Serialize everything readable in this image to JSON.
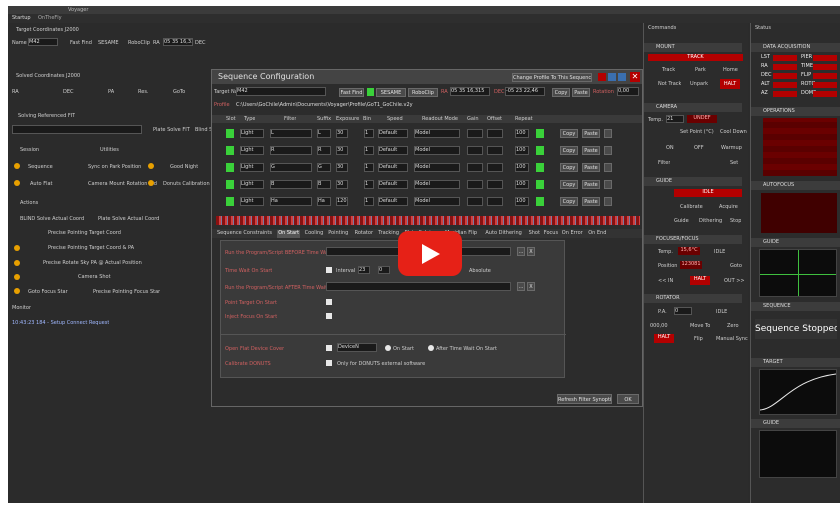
{
  "window": {
    "title": "Voyager",
    "tabs": [
      "Startup",
      "OnTheFly"
    ]
  },
  "left": {
    "target_coords_header": "Target Coordinates J2000",
    "name_label": "Name",
    "name_value": "M42",
    "fast_find": "Fast Find",
    "sesame": "SESAME",
    "roboclip": "RoboClip",
    "ra_label": "RA",
    "ra_value": "05 35 16,315",
    "dec_label": "DEC",
    "dec_value": "-05 23 22,46",
    "transit": "Transit",
    "goto": "Goto",
    "solved_header": "Solved Coordinates J2000",
    "solved_ra": "RA",
    "solved_dec": "DEC",
    "solved_pa": "PA",
    "solved_res": "Res.",
    "goto_btn": "GoTo",
    "solving_fit": "Solving Referenced FIT",
    "plate_solve_fit": "Plate Solve FIT",
    "blind_solve": "Blind Sol",
    "session": "Session",
    "utilities": "Utilities",
    "sequence": "Sequence",
    "sync_park": "Sync on Park Position",
    "good_night": "Good Night",
    "auto_flat": "Auto Flat",
    "camera_mount_rotation": "Camera Mount Rotation Aid",
    "donuts_calibration": "Donuts Calibration",
    "actions": "Actions",
    "blind_solve_actual": "BLIND Solve Actual Coord",
    "plate_solve_actual": "Plate Solve Actual Coord",
    "precise_target_coord": "Precise Pointing Target Coord",
    "precise_target_pa": "Precise Pointing Target Coord & PA",
    "precise_rotate_sky": "Precise Rotate Sky PA @ Actual Position",
    "camera_shot": "Camera Shot",
    "goto_focus_star": "Goto Focus Star",
    "precise_focus_star": "Precise Pointing Focus Star",
    "monitor_header": "Monitor",
    "monitor_log": "10:43:23 184 - Setup Connect Request"
  },
  "dialog": {
    "title": "Sequence Configuration",
    "change_profile": "Change Profile To This Sequence",
    "target_name_label": "Target Name",
    "target_name": "M42",
    "fast_find": "Fast Find",
    "sesame": "SESAME",
    "roboclip": "RoboClip",
    "ra_label": "RA",
    "ra_value": "05 35 16,315",
    "dec_label": "DEC",
    "dec_value": "-05 23 22,46",
    "copy": "Copy",
    "paste": "Paste",
    "rotation_label": "Rotation",
    "rotation_value": "0,00",
    "profile_label": "Profile",
    "profile_path": "C:\\Users\\GoChile\\Admin\\Documents\\Voyager\\Profile\\GoT1_GoChile.v2y",
    "columns": [
      "Slot",
      "Type",
      "Filter",
      "Suffix",
      "Exposure",
      "Bin",
      "Speed",
      "Readout Mode",
      "Gain",
      "Offset",
      "Repeat"
    ],
    "rows": [
      {
        "type": "Light",
        "filter": "L",
        "suffix": "L",
        "exposure": "30",
        "bin": "1",
        "speed": "Default",
        "readout": "Model",
        "repeat": "100"
      },
      {
        "type": "Light",
        "filter": "R",
        "suffix": "R",
        "exposure": "30",
        "bin": "1",
        "speed": "Default",
        "readout": "Model",
        "repeat": "100"
      },
      {
        "type": "Light",
        "filter": "G",
        "suffix": "G",
        "exposure": "30",
        "bin": "1",
        "speed": "Default",
        "readout": "Model",
        "repeat": "100"
      },
      {
        "type": "Light",
        "filter": "B",
        "suffix": "B",
        "exposure": "30",
        "bin": "1",
        "speed": "Default",
        "readout": "Model",
        "repeat": "100"
      },
      {
        "type": "Light",
        "filter": "Ha",
        "suffix": "Ha",
        "exposure": "120",
        "bin": "1",
        "speed": "Default",
        "readout": "Model",
        "repeat": "100"
      }
    ],
    "tabs": [
      "Sequence",
      "Constraints",
      "On Start",
      "Cooling",
      "Pointing",
      "Rotator",
      "Tracking",
      "Plate Solving",
      "Meridian Flip",
      "Auto Dithering",
      "Shot",
      "Focus",
      "On Error",
      "On End"
    ],
    "active_tab": "On Start",
    "on_start": {
      "run_before": "Run the Program/Script BEFORE Time Wait",
      "time_wait": "Time Wait On Start",
      "interval": "Interval",
      "interval_h": "23",
      "interval_m": "0",
      "absolute": "Absolute",
      "run_after": "Run the Program/Script AFTER Time Wait",
      "point_target": "Point Target On Start",
      "inject_focus": "Inject Focus On Start",
      "open_flat": "Open Flat Device Cover",
      "flat_device": "DeviceN",
      "on_start_radio": "On Start",
      "after_time_radio": "After Time Wait On Start",
      "calibrate_donuts": "Calibrate DONUTS",
      "only_donuts": "Only for DONUTS external software"
    },
    "refresh": "Refresh Filter Synoptic",
    "ok": "OK"
  },
  "right": {
    "commands": "Commands",
    "mount": "MOUNT",
    "track_status": "TRACK",
    "track": "Track",
    "park": "Park",
    "home": "Home",
    "not_track": "Not Track",
    "unpark": "Unpark",
    "halt": "HALT",
    "camera": "CAMERA",
    "temp_label": "Temp.",
    "temp_value": "21",
    "temp_status": "UNDEF",
    "setpoint": "Set Point (°C)",
    "cool_down": "Cool Down",
    "on": "ON",
    "off": "OFF",
    "warmup": "Warmup",
    "filter": "Filter",
    "set": "Set",
    "guide": "GUIDE",
    "idle": "IDLE",
    "calibrate": "Calibrate",
    "acquire": "Acquire",
    "guide_btn": "Guide",
    "dithering": "Dithering",
    "stop": "Stop",
    "focuser": "FOCUSER/FOCUS",
    "focus_temp": "15,6°C",
    "focus_idle": "IDLE",
    "position": "Position",
    "position_value": "123081",
    "goto": "Goto",
    "in": "<< IN",
    "out": "OUT >>",
    "focus_halt": "HALT",
    "rotator": "ROTATOR",
    "pa_label": "P.A.",
    "pa_value": "0",
    "pa_idle": "IDLE",
    "pa_input": "000,00",
    "move_to": "Move To",
    "zero": "Zero",
    "rot_halt": "HALT",
    "flip": "Flip",
    "manual_sync": "Manual Sync"
  },
  "status": {
    "title": "Status",
    "data_acq": "DATA ACQUISITION",
    "lst": "LST",
    "pier": "PIER",
    "ra": "RA",
    "time": "TIME",
    "dec": "DEC",
    "flip": "FLIP",
    "alt": "ALT",
    "rotation": "ROTO",
    "az": "AZ",
    "dome": "DOME",
    "operations": "OPERATIONS",
    "autofocus": "AUTOFOCUS",
    "guide": "GUIDE",
    "sequence": "SEQUENCE",
    "sequence_status": "Sequence Stopped",
    "target": "TARGET",
    "guide2": "GUIDE"
  }
}
